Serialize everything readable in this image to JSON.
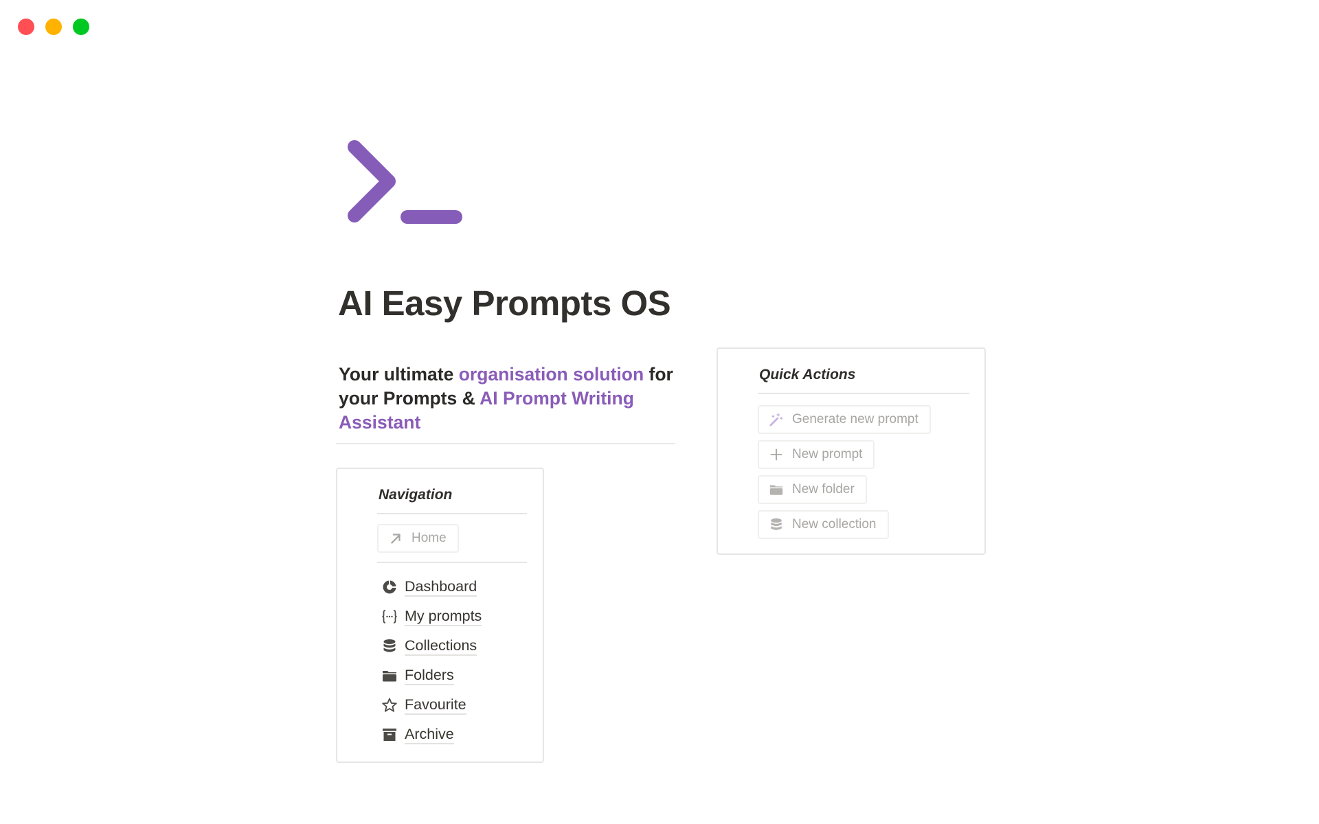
{
  "window": {
    "controls": [
      "close",
      "minimize",
      "maximize"
    ]
  },
  "page": {
    "icon": "terminal-prompt-icon",
    "title": "AI Easy Prompts OS",
    "subtitle": {
      "part1": "Your ultimate ",
      "accent1": "organisation solution",
      "part2": " for your Prompts & ",
      "accent2": "AI Prompt Writing Assistant"
    }
  },
  "colors": {
    "accent": "#8a5cb8",
    "text": "#37352f",
    "muted": "#a7a6a3"
  },
  "navigation": {
    "heading": "Navigation",
    "home_button": {
      "label": "Home",
      "icon": "arrow-up-right-icon"
    },
    "items": [
      {
        "label": "Dashboard",
        "icon": "pie-chart-icon"
      },
      {
        "label": "My prompts",
        "icon": "braces-icon"
      },
      {
        "label": "Collections",
        "icon": "database-icon"
      },
      {
        "label": "Folders",
        "icon": "folder-icon"
      },
      {
        "label": "Favourite",
        "icon": "star-icon"
      },
      {
        "label": "Archive",
        "icon": "archive-icon"
      }
    ]
  },
  "quick_actions": {
    "heading": "Quick Actions",
    "buttons": [
      {
        "label": "Generate new prompt",
        "icon": "magic-wand-icon"
      },
      {
        "label": "New prompt",
        "icon": "plus-icon"
      },
      {
        "label": "New folder",
        "icon": "folder-icon"
      },
      {
        "label": "New collection",
        "icon": "database-icon"
      }
    ]
  }
}
